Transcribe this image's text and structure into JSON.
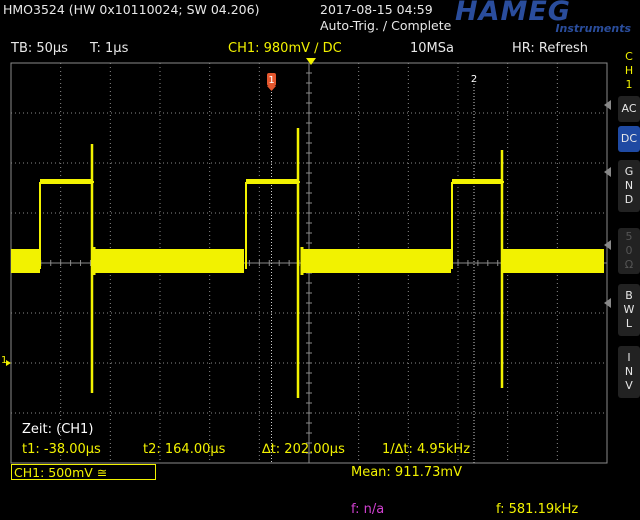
{
  "header": {
    "device": "HMO3524 (HW 0x10110024; SW 04.206)",
    "datetime": "2017-08-15 04:59",
    "trigger_status": "Auto-Trig. / Complete",
    "logo_main": "HAMEG",
    "logo_sub": "Instruments"
  },
  "status_bar": {
    "timebase": "TB: 50µs",
    "trigger_time": "T: 1µs",
    "channel": "CH1: 980mV ∕ DC",
    "sample_rate": "10MSa",
    "mode": "HR: Refresh"
  },
  "sidebar": {
    "channel_label": [
      "C",
      "H",
      "1"
    ],
    "coupling_ac": "AC",
    "coupling_dc": "DC",
    "gnd": [
      "G",
      "N",
      "D"
    ],
    "imp": [
      "5",
      "0",
      "Ω"
    ],
    "bwl": [
      "B",
      "W",
      "L"
    ],
    "inv": [
      "I",
      "N",
      "V"
    ]
  },
  "markers": {
    "cursor1": "1",
    "cursor2": "2",
    "channel_ground": "1"
  },
  "measurements": {
    "zeit": "Zeit: (CH1)",
    "t1": "t1: -38.00µs",
    "t2": "t2: 164.00µs",
    "dt": "∆t: 202.00µs",
    "inv_dt": "1/∆t: 4.95kHz"
  },
  "footer": {
    "ch1_scale": "CH1: 500mV ≅",
    "mean": "Mean: 911.73mV",
    "f_na": "f: n/a",
    "freq": "f: 581.19kHz"
  },
  "colors": {
    "trace": "#f2f200",
    "grid": "#8a8a8a",
    "cursor_marker": "#e4572e",
    "accent": "#1f4aa3"
  }
}
